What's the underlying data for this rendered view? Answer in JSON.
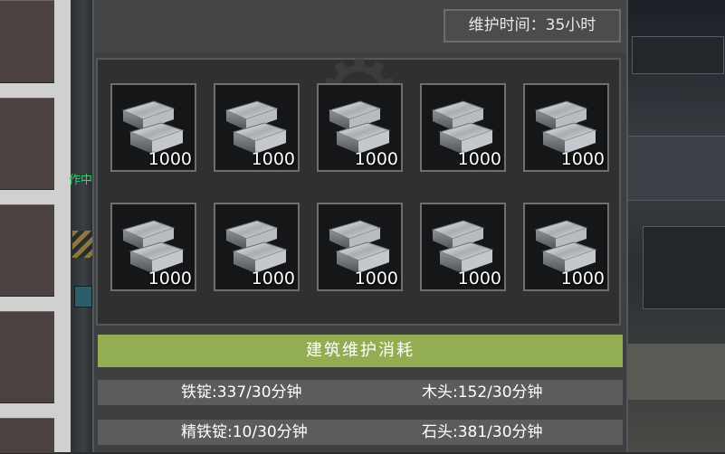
{
  "header": {
    "maintenance_time": "维护时间：35小时"
  },
  "side_status": {
    "working_label": "作中"
  },
  "items": [
    {
      "icon": "silver-ingot-icon",
      "quantity": "1000"
    },
    {
      "icon": "silver-ingot-icon",
      "quantity": "1000"
    },
    {
      "icon": "silver-ingot-icon",
      "quantity": "1000"
    },
    {
      "icon": "silver-ingot-icon",
      "quantity": "1000"
    },
    {
      "icon": "silver-ingot-icon",
      "quantity": "1000"
    },
    {
      "icon": "silver-ingot-icon",
      "quantity": "1000"
    },
    {
      "icon": "silver-ingot-icon",
      "quantity": "1000"
    },
    {
      "icon": "silver-ingot-icon",
      "quantity": "1000"
    },
    {
      "icon": "silver-ingot-icon",
      "quantity": "1000"
    },
    {
      "icon": "silver-ingot-icon",
      "quantity": "1000"
    }
  ],
  "consumption": {
    "title": "建筑维护消耗",
    "rows": [
      {
        "left": "铁锭:337/30分钟",
        "right": "木头:152/30分钟"
      },
      {
        "left": "精铁锭:10/30分钟",
        "right": "石头:381/30分钟"
      }
    ]
  },
  "colors": {
    "header_green": "#93ad52",
    "working_green": "#36d36a"
  }
}
